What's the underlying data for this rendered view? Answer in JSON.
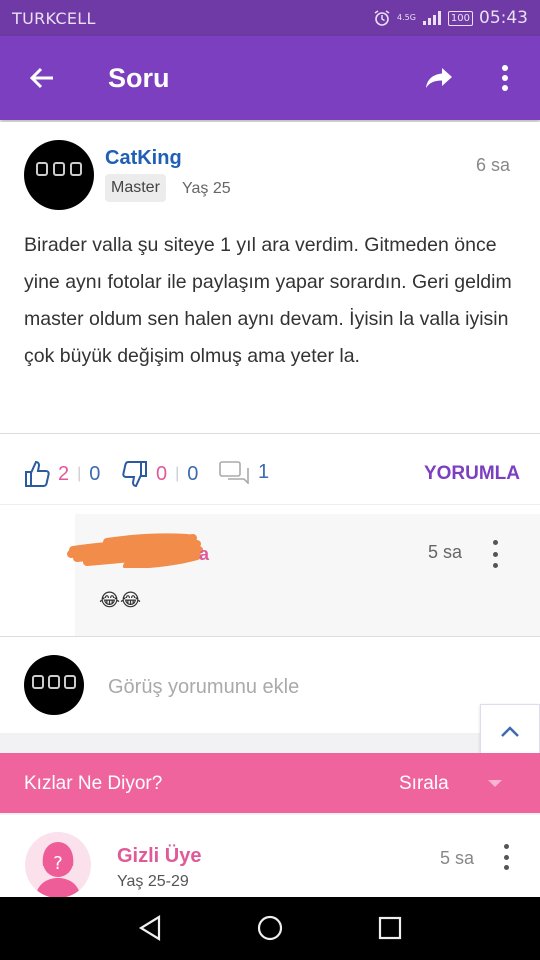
{
  "status": {
    "carrier": "TURKCELL",
    "network": "4.5G",
    "battery": "100",
    "time": "05:43"
  },
  "appbar": {
    "title": "Soru"
  },
  "post": {
    "username": "CatKing",
    "level": "Master",
    "age": "Yaş 25",
    "time": "6 sa",
    "text": "Birader valla şu siteye 1 yıl ara verdim. Gitmeden önce yine aynı fotolar ile paylaşım yapar sorardın. Geri geldim master oldum sen halen aynı devam. İyisin la valla iyisin çok büyük değişim olmuş ama yeter la."
  },
  "actions": {
    "likes_women": "2",
    "likes_men": "0",
    "dislikes_women": "0",
    "dislikes_men": "0",
    "comments": "1",
    "comment_button": "YORUMLA"
  },
  "reply": {
    "name_fragment": "a",
    "time": "5 sa",
    "text": "😂😂"
  },
  "comment_input": {
    "placeholder": "Görüş yorumunu ekle"
  },
  "section": {
    "title": "Kızlar Ne Diyor?",
    "sort_label": "Sırala"
  },
  "answer": {
    "name": "Gizli Üye",
    "age": "Yaş 25-29",
    "time": "5 sa"
  },
  "colors": {
    "status_bar": "#6f3aa5",
    "app_bar": "#7c3fbf",
    "accent_pink": "#f0649e",
    "username_blue": "#1f5fb4"
  }
}
